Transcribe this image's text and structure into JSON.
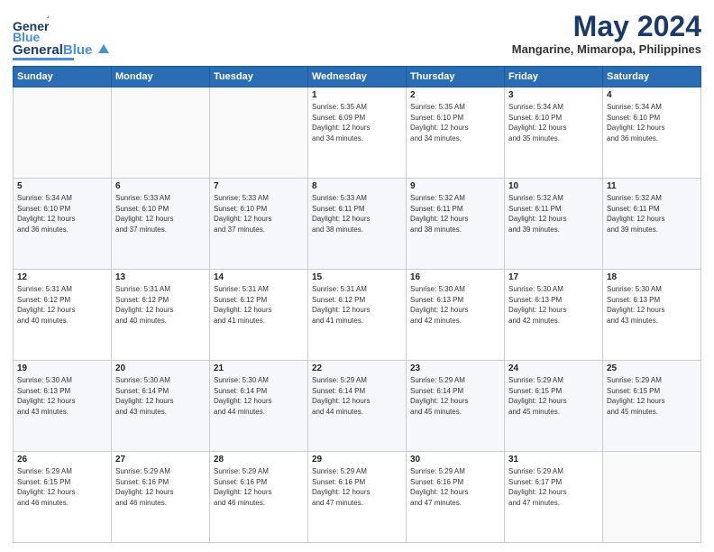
{
  "header": {
    "logo_general": "General",
    "logo_blue": "Blue",
    "month_title": "May 2024",
    "location": "Mangarine, Mimaropa, Philippines"
  },
  "days_of_week": [
    "Sunday",
    "Monday",
    "Tuesday",
    "Wednesday",
    "Thursday",
    "Friday",
    "Saturday"
  ],
  "weeks": [
    [
      {
        "day": "",
        "info": ""
      },
      {
        "day": "",
        "info": ""
      },
      {
        "day": "",
        "info": ""
      },
      {
        "day": "1",
        "info": "Sunrise: 5:35 AM\nSunset: 6:09 PM\nDaylight: 12 hours\nand 34 minutes."
      },
      {
        "day": "2",
        "info": "Sunrise: 5:35 AM\nSunset: 6:10 PM\nDaylight: 12 hours\nand 34 minutes."
      },
      {
        "day": "3",
        "info": "Sunrise: 5:34 AM\nSunset: 6:10 PM\nDaylight: 12 hours\nand 35 minutes."
      },
      {
        "day": "4",
        "info": "Sunrise: 5:34 AM\nSunset: 6:10 PM\nDaylight: 12 hours\nand 36 minutes."
      }
    ],
    [
      {
        "day": "5",
        "info": "Sunrise: 5:34 AM\nSunset: 6:10 PM\nDaylight: 12 hours\nand 36 minutes."
      },
      {
        "day": "6",
        "info": "Sunrise: 5:33 AM\nSunset: 6:10 PM\nDaylight: 12 hours\nand 37 minutes."
      },
      {
        "day": "7",
        "info": "Sunrise: 5:33 AM\nSunset: 6:10 PM\nDaylight: 12 hours\nand 37 minutes."
      },
      {
        "day": "8",
        "info": "Sunrise: 5:33 AM\nSunset: 6:11 PM\nDaylight: 12 hours\nand 38 minutes."
      },
      {
        "day": "9",
        "info": "Sunrise: 5:32 AM\nSunset: 6:11 PM\nDaylight: 12 hours\nand 38 minutes."
      },
      {
        "day": "10",
        "info": "Sunrise: 5:32 AM\nSunset: 6:11 PM\nDaylight: 12 hours\nand 39 minutes."
      },
      {
        "day": "11",
        "info": "Sunrise: 5:32 AM\nSunset: 6:11 PM\nDaylight: 12 hours\nand 39 minutes."
      }
    ],
    [
      {
        "day": "12",
        "info": "Sunrise: 5:31 AM\nSunset: 6:12 PM\nDaylight: 12 hours\nand 40 minutes."
      },
      {
        "day": "13",
        "info": "Sunrise: 5:31 AM\nSunset: 6:12 PM\nDaylight: 12 hours\nand 40 minutes."
      },
      {
        "day": "14",
        "info": "Sunrise: 5:31 AM\nSunset: 6:12 PM\nDaylight: 12 hours\nand 41 minutes."
      },
      {
        "day": "15",
        "info": "Sunrise: 5:31 AM\nSunset: 6:12 PM\nDaylight: 12 hours\nand 41 minutes."
      },
      {
        "day": "16",
        "info": "Sunrise: 5:30 AM\nSunset: 6:13 PM\nDaylight: 12 hours\nand 42 minutes."
      },
      {
        "day": "17",
        "info": "Sunrise: 5:30 AM\nSunset: 6:13 PM\nDaylight: 12 hours\nand 42 minutes."
      },
      {
        "day": "18",
        "info": "Sunrise: 5:30 AM\nSunset: 6:13 PM\nDaylight: 12 hours\nand 43 minutes."
      }
    ],
    [
      {
        "day": "19",
        "info": "Sunrise: 5:30 AM\nSunset: 6:13 PM\nDaylight: 12 hours\nand 43 minutes."
      },
      {
        "day": "20",
        "info": "Sunrise: 5:30 AM\nSunset: 6:14 PM\nDaylight: 12 hours\nand 43 minutes."
      },
      {
        "day": "21",
        "info": "Sunrise: 5:30 AM\nSunset: 6:14 PM\nDaylight: 12 hours\nand 44 minutes."
      },
      {
        "day": "22",
        "info": "Sunrise: 5:29 AM\nSunset: 6:14 PM\nDaylight: 12 hours\nand 44 minutes."
      },
      {
        "day": "23",
        "info": "Sunrise: 5:29 AM\nSunset: 6:14 PM\nDaylight: 12 hours\nand 45 minutes."
      },
      {
        "day": "24",
        "info": "Sunrise: 5:29 AM\nSunset: 6:15 PM\nDaylight: 12 hours\nand 45 minutes."
      },
      {
        "day": "25",
        "info": "Sunrise: 5:29 AM\nSunset: 6:15 PM\nDaylight: 12 hours\nand 45 minutes."
      }
    ],
    [
      {
        "day": "26",
        "info": "Sunrise: 5:29 AM\nSunset: 6:15 PM\nDaylight: 12 hours\nand 46 minutes."
      },
      {
        "day": "27",
        "info": "Sunrise: 5:29 AM\nSunset: 6:16 PM\nDaylight: 12 hours\nand 46 minutes."
      },
      {
        "day": "28",
        "info": "Sunrise: 5:29 AM\nSunset: 6:16 PM\nDaylight: 12 hours\nand 46 minutes."
      },
      {
        "day": "29",
        "info": "Sunrise: 5:29 AM\nSunset: 6:16 PM\nDaylight: 12 hours\nand 47 minutes."
      },
      {
        "day": "30",
        "info": "Sunrise: 5:29 AM\nSunset: 6:16 PM\nDaylight: 12 hours\nand 47 minutes."
      },
      {
        "day": "31",
        "info": "Sunrise: 5:29 AM\nSunset: 6:17 PM\nDaylight: 12 hours\nand 47 minutes."
      },
      {
        "day": "",
        "info": ""
      }
    ]
  ]
}
